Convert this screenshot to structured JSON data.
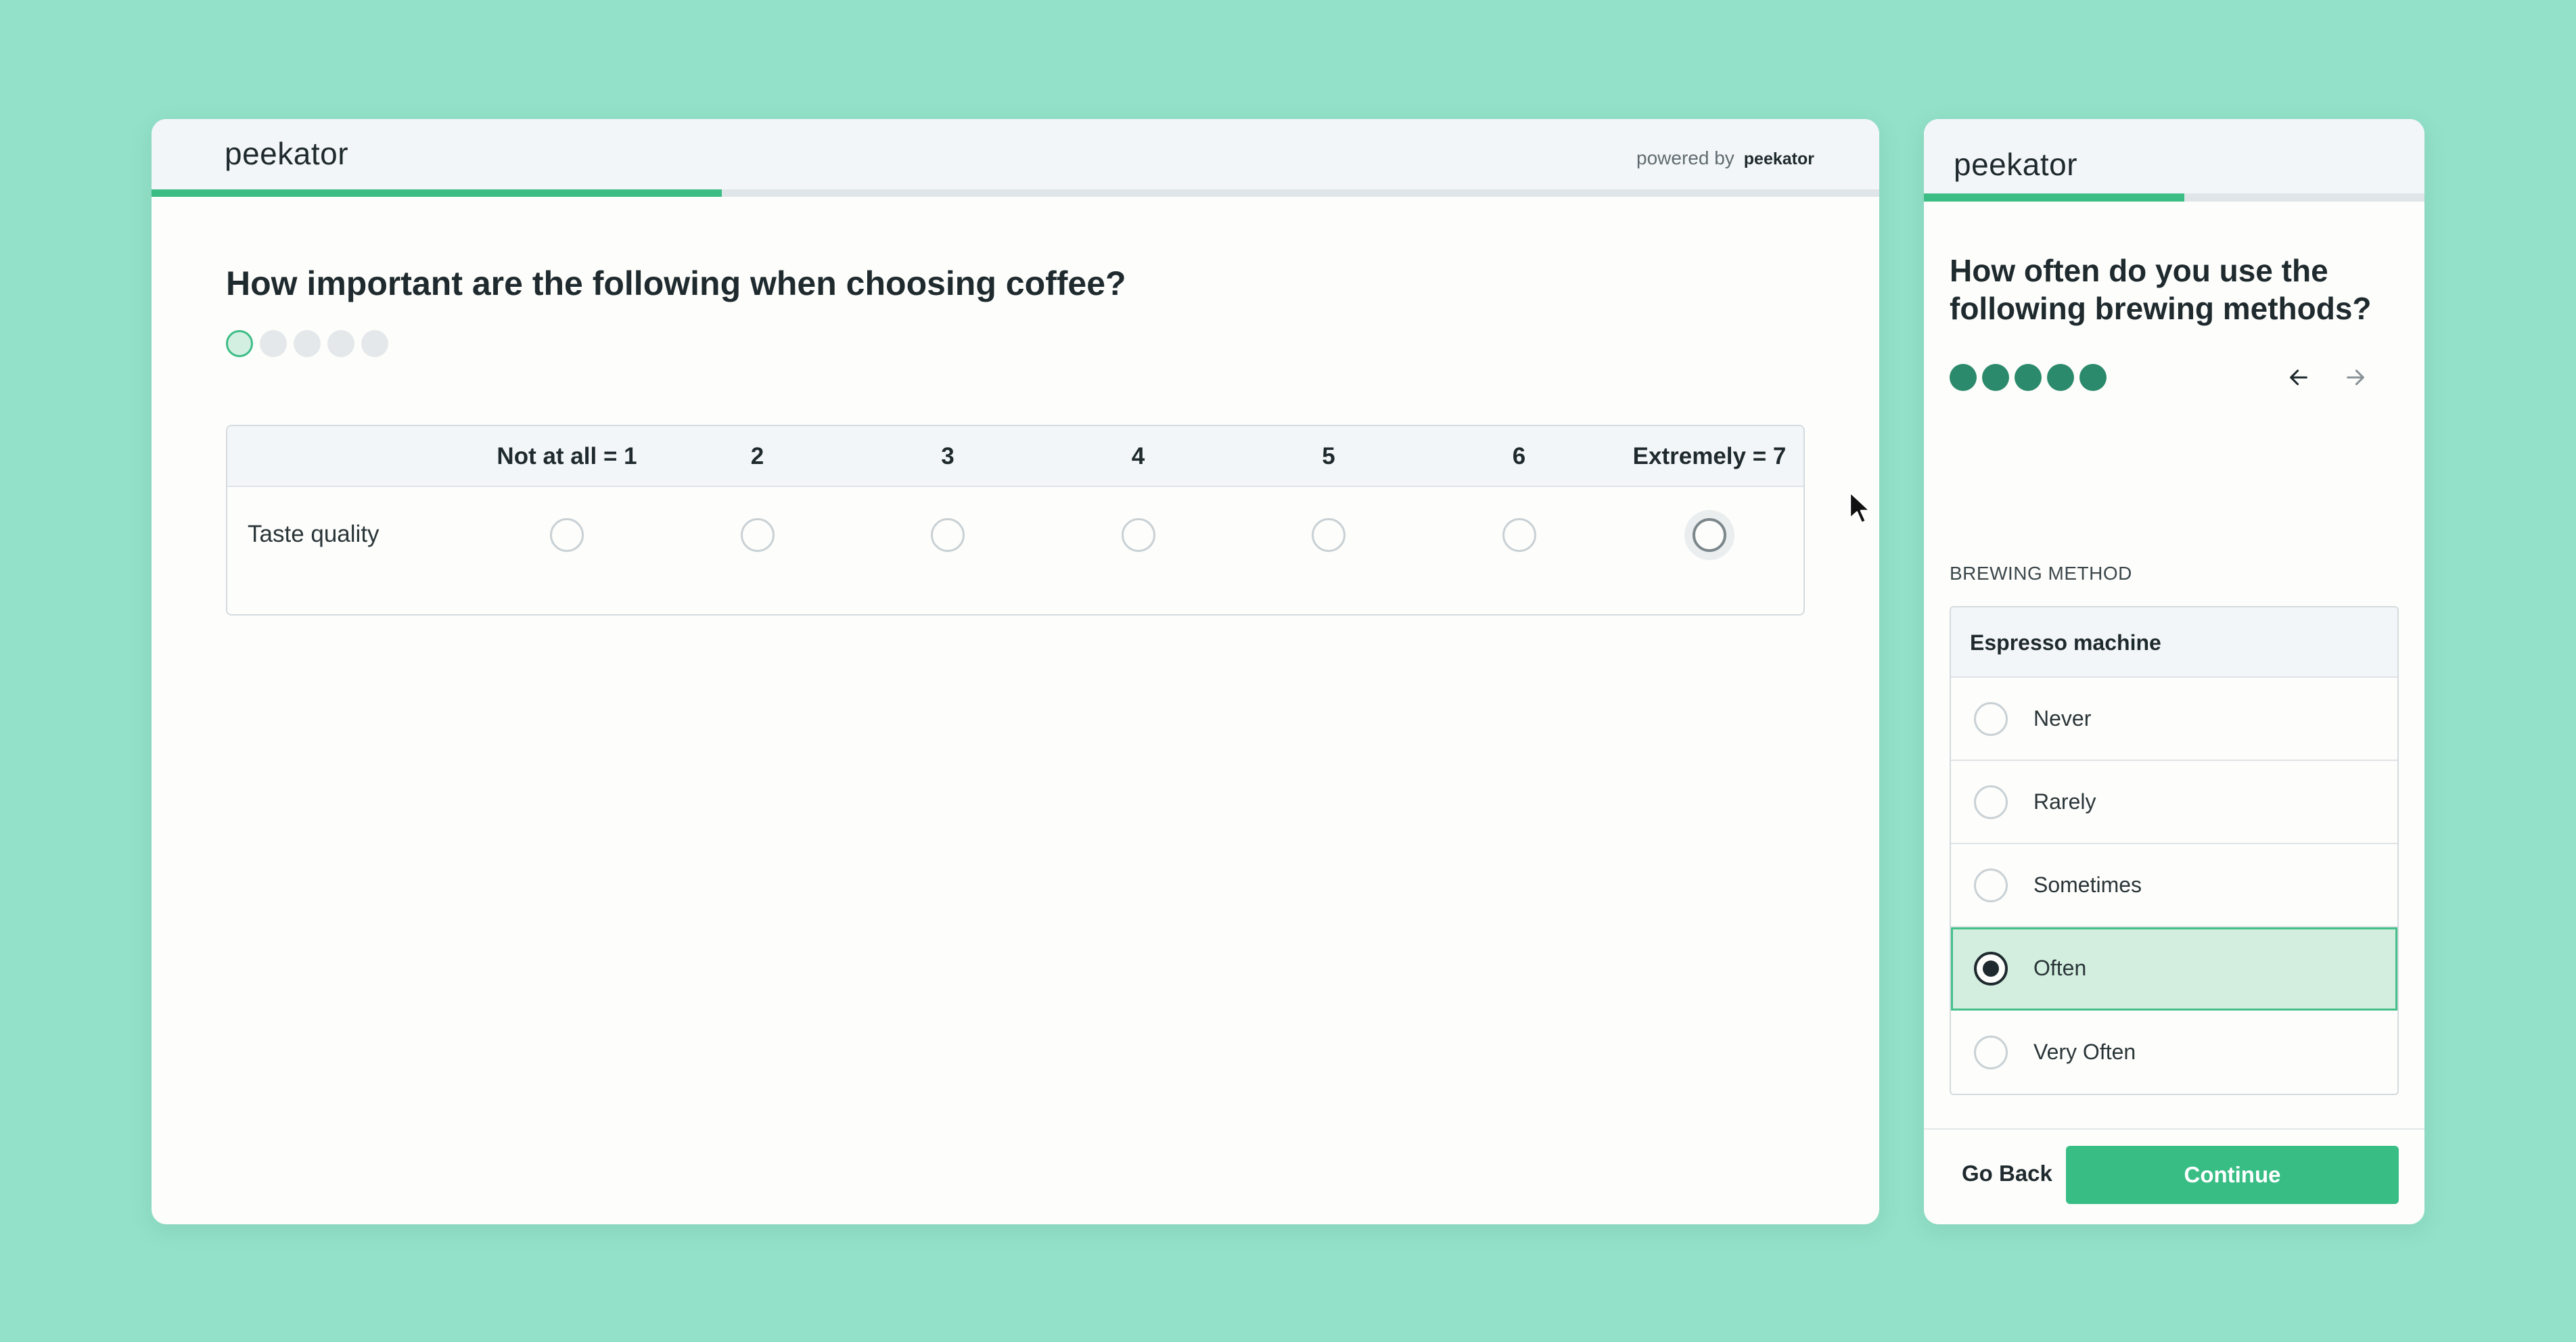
{
  "left_panel": {
    "logo": "peekator",
    "powered_by_label": "powered by",
    "powered_by_logo": "peekator",
    "progress_percent": 33,
    "question": "How important are the following when choosing coffee?",
    "steps_total": 5,
    "current_step": 1,
    "matrix": {
      "columns": [
        "Not at all = 1",
        "2",
        "3",
        "4",
        "5",
        "6",
        "Extremely = 7"
      ],
      "rows": [
        {
          "label": "Taste quality",
          "selected": null
        }
      ]
    }
  },
  "right_panel": {
    "logo": "peekator",
    "progress_percent": 52,
    "question": "How often do you use the following brewing methods?",
    "steps_total": 5,
    "steps_completed": 5,
    "nav": {
      "prev_icon": "arrow-left-icon",
      "next_icon": "arrow-right-icon"
    },
    "section_label": "BREWING METHOD",
    "group_title": "Espresso machine",
    "options": [
      {
        "label": "Never",
        "selected": false
      },
      {
        "label": "Rarely",
        "selected": false
      },
      {
        "label": "Sometimes",
        "selected": false
      },
      {
        "label": "Often",
        "selected": true
      },
      {
        "label": "Very Often",
        "selected": false
      }
    ],
    "footer": {
      "back_label": "Go Back",
      "continue_label": "Continue"
    }
  },
  "colors": {
    "background": "#93e1c8",
    "accent": "#3cbd86",
    "step_dot_done": "#2b8a6c",
    "selected_bg": "#d3eedf"
  }
}
